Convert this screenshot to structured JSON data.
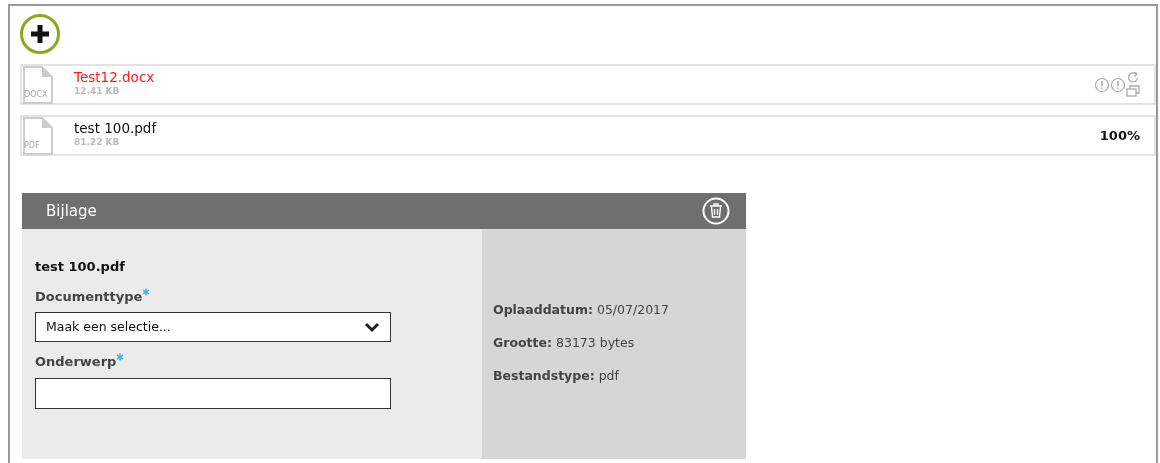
{
  "files": [
    {
      "name": "Test12.docx",
      "size": "12.41 KB",
      "type_label": "DOCX",
      "error": true,
      "actions": [
        {
          "kind": "warning"
        },
        {
          "kind": "warning"
        },
        {
          "kind": "retry"
        }
      ]
    },
    {
      "name": "test 100.pdf",
      "size": "81.22 KB",
      "type_label": "PDF",
      "error": false,
      "progress": "100%"
    }
  ],
  "attachment": {
    "title": "Bijlage",
    "file_name": "test 100.pdf",
    "fields": [
      {
        "kind": "select",
        "label": "Documenttype",
        "required": true,
        "value": "Maak een selectie..."
      },
      {
        "kind": "text",
        "label": "Onderwerp",
        "required": true
      }
    ],
    "details": [
      {
        "label": "Oplaaddatum:",
        "value": "05/07/2017"
      },
      {
        "label": "Grootte:",
        "value": "83173 bytes"
      },
      {
        "label": "Bestandstype:",
        "value": "pdf"
      }
    ]
  }
}
